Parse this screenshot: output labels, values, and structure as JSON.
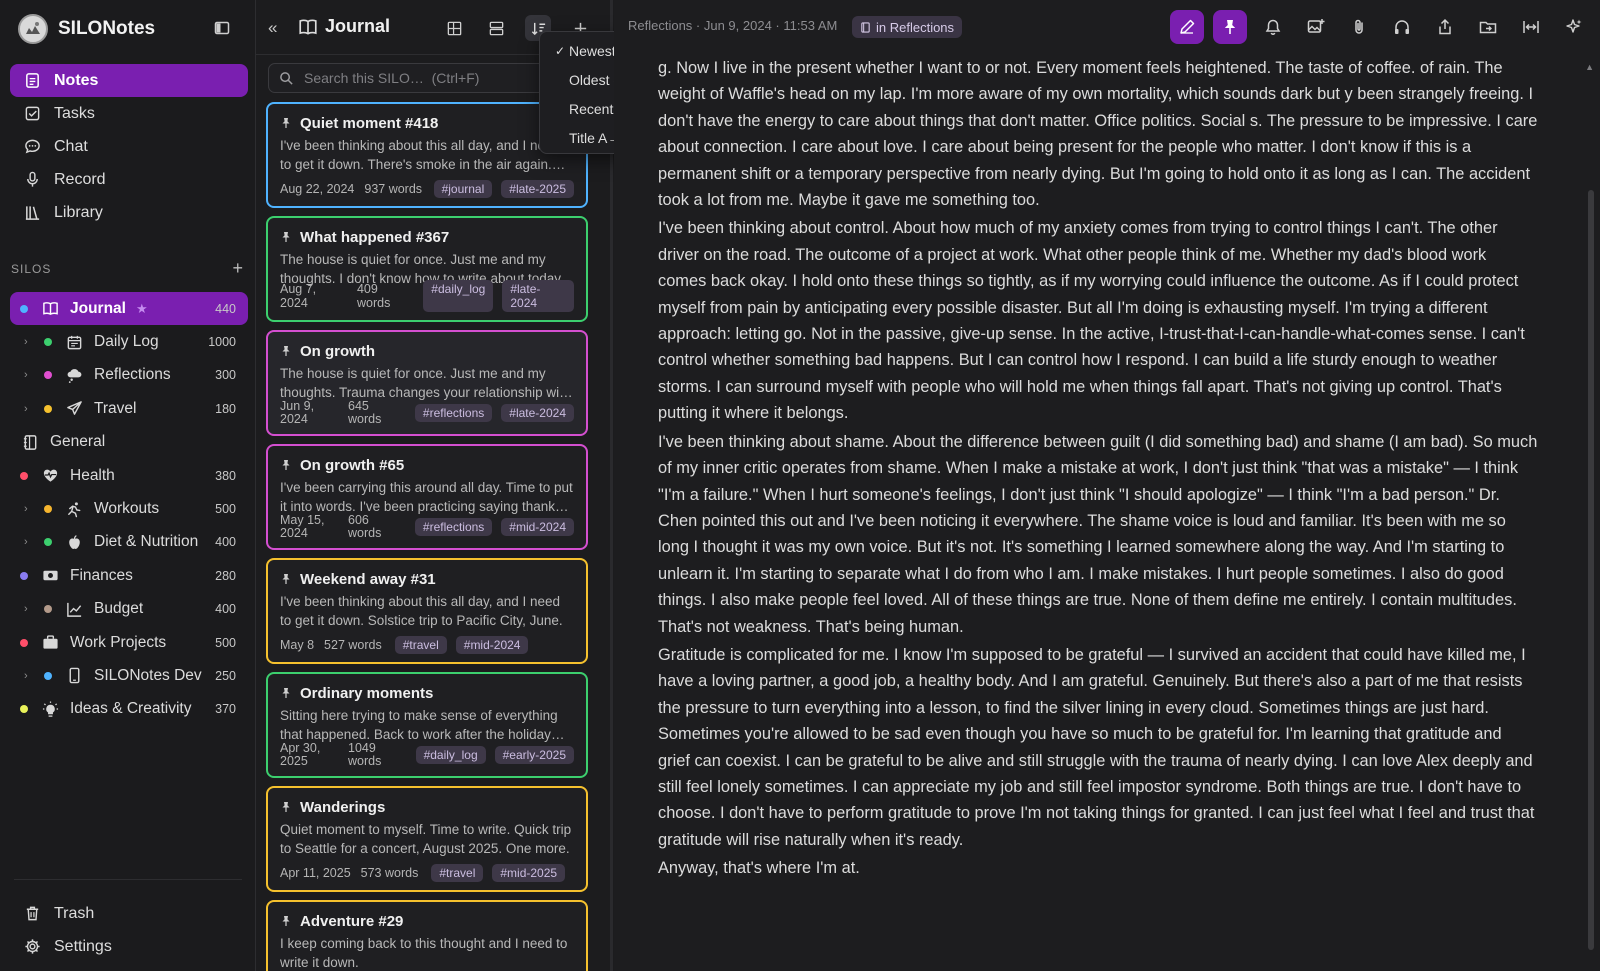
{
  "app": {
    "name": "SILONotes"
  },
  "nav": [
    {
      "label": "Notes",
      "icon": "notes-icon",
      "active": true
    },
    {
      "label": "Tasks",
      "icon": "tasks-icon"
    },
    {
      "label": "Chat",
      "icon": "chat-icon"
    },
    {
      "label": "Record",
      "icon": "microphone-icon"
    },
    {
      "label": "Library",
      "icon": "library-icon"
    }
  ],
  "silos_header": {
    "label": "SILOS",
    "add": "+"
  },
  "silos": [
    {
      "label": "Journal",
      "count": "440",
      "dot": "#4fb3ff",
      "icon": "book-icon",
      "active": true,
      "star": "★"
    },
    {
      "label": "Daily Log",
      "count": "1000",
      "dot": "#3ccf6e",
      "icon": "calendar-icon",
      "chevron": "›"
    },
    {
      "label": "Reflections",
      "count": "300",
      "dot": "#e04fd0",
      "icon": "thought-icon",
      "chevron": "›"
    },
    {
      "label": "Travel",
      "count": "180",
      "dot": "#f5c12e",
      "icon": "plane-icon",
      "chevron": "›"
    },
    {
      "label": "General",
      "count": "",
      "dot": "",
      "icon": "notebook-icon"
    },
    {
      "label": "Health",
      "count": "380",
      "dot": "#ff4f6a",
      "icon": "heartbeat-icon"
    },
    {
      "label": "Workouts",
      "count": "500",
      "dot": "#f5b52e",
      "icon": "run-icon",
      "chevron": "›"
    },
    {
      "label": "Diet & Nutrition",
      "count": "400",
      "dot": "#3ccf6e",
      "icon": "apple-icon",
      "chevron": "›"
    },
    {
      "label": "Finances",
      "count": "280",
      "dot": "#8a7cf0",
      "icon": "money-icon"
    },
    {
      "label": "Budget",
      "count": "400",
      "dot": "#b39a8a",
      "icon": "chart-line-icon",
      "chevron": "›"
    },
    {
      "label": "Work Projects",
      "count": "500",
      "dot": "#ff4f6a",
      "icon": "briefcase-icon"
    },
    {
      "label": "SILONotes Dev",
      "count": "250",
      "dot": "#4fb3ff",
      "icon": "phone-icon",
      "chevron": "›"
    },
    {
      "label": "Ideas & Creativity",
      "count": "370",
      "dot": "#e9f25a",
      "icon": "lightbulb-icon"
    }
  ],
  "bottom_nav": [
    {
      "label": "Trash",
      "icon": "trash-icon"
    },
    {
      "label": "Settings",
      "icon": "gear-icon"
    }
  ],
  "list": {
    "back": "«",
    "title": "Journal",
    "search_placeholder": "Search this SILO…  (Ctrl+F)"
  },
  "sort_menu": {
    "items": [
      {
        "label": "Newest created",
        "checked": "✓"
      },
      {
        "label": "Oldest created",
        "checked": ""
      },
      {
        "label": "Recently updated",
        "checked": ""
      },
      {
        "label": "Title A→Z",
        "checked": ""
      }
    ]
  },
  "notes": [
    {
      "title": "Quiet moment #418",
      "excerpt": "I've been thinking about this all day, and I need to get it down. There's smoke in the air again. Fire season is here.",
      "date": "Aug 22, 2024",
      "words": "937 words",
      "tags": [
        "#journal",
        "#late-2025"
      ],
      "color": "#4fb3ff"
    },
    {
      "title": "What happened #367",
      "excerpt": "The house is quiet for once. Just me and my thoughts. I don't know how to write about today.",
      "date": "Aug 7, 2024",
      "words": "409 words",
      "tags": [
        "#daily_log",
        "#late-2024"
      ],
      "color": "#3ccf6e"
    },
    {
      "title": "On growth",
      "excerpt": "The house is quiet for once. Just me and my thoughts. Trauma changes your relationship with time.",
      "date": "Jun 9, 2024",
      "words": "645 words",
      "tags": [
        "#reflections",
        "#late-2024"
      ],
      "color": "#d44fd0",
      "selected": true,
      "stack": true
    },
    {
      "title": "On growth #65",
      "excerpt": "I've been carrying this around all day. Time to put it into words. I've been practicing saying thank you.",
      "date": "May 15, 2024",
      "words": "606 words",
      "tags": [
        "#reflections",
        "#mid-2024"
      ],
      "color": "#d44fd0",
      "stack": true
    },
    {
      "title": "Weekend away #31",
      "excerpt": "I've been thinking about this all day, and I need to get it down. Solstice trip to Pacific City, June.",
      "date": "May 8",
      "words": "527 words",
      "tags": [
        "#travel",
        "#mid-2024"
      ],
      "color": "#f5c12e"
    },
    {
      "title": "Ordinary moments",
      "excerpt": "Sitting here trying to make sense of everything that happened. Back to work after the holiday break.",
      "date": "Apr 30, 2025",
      "words": "1049 words",
      "tags": [
        "#daily_log",
        "#early-2025"
      ],
      "color": "#3ccf6e",
      "stack": true
    },
    {
      "title": "Wanderings",
      "excerpt": "Quiet moment to myself. Time to write. Quick trip to Seattle for a concert, August 2025. One more.",
      "date": "Apr 11, 2025",
      "words": "573 words",
      "tags": [
        "#travel",
        "#mid-2025"
      ],
      "color": "#f5c12e"
    },
    {
      "title": "Adventure #29",
      "excerpt": "I keep coming back to this thought and I need to write it down.",
      "date": "",
      "words": "",
      "tags": [],
      "color": "#f5c12e"
    }
  ],
  "editor": {
    "breadcrumb": "Reflections · Jun 9, 2024 · 11:53 AM",
    "silo_chip": "in Reflections",
    "tools": [
      "pencil-icon",
      "pin-icon",
      "bell-icon",
      "image-add-icon",
      "paperclip-icon",
      "headphones-icon",
      "share-icon",
      "folder-move-icon",
      "expand-width-icon",
      "sparkle-icon"
    ],
    "paragraphs": [
      "g. Now I live in the present whether I want to or not. Every moment feels heightened. The taste of coffee. of rain. The weight of Waffle's head on my lap. I'm more aware of my own mortality, which sounds dark but y been strangely freeing. I don't have the energy to care about things that don't matter. Office politics. Social s. The pressure to be impressive. I care about connection. I care about love. I care about being present for the people who matter. I don't know if this is a permanent shift or a temporary perspective from nearly dying. But I'm going to hold onto it as long as I can. The accident took a lot from me. Maybe it gave me something too.",
      "I've been thinking about control. About how much of my anxiety comes from trying to control things I can't. The other driver on the road. The outcome of a project at work. What other people think of me. Whether my dad's blood work comes back okay. I hold onto these things so tightly, as if my worrying could influence the outcome. As if I could protect myself from pain by anticipating every possible disaster. But all I'm doing is exhausting myself. I'm trying a different approach: letting go. Not in the passive, give-up sense. In the active, I-trust-that-I-can-handle-what-comes sense. I can't control whether something bad happens. But I can control how I respond. I can build a life sturdy enough to weather storms. I can surround myself with people who will hold me when things fall apart. That's not giving up control. That's putting it where it belongs.",
      "I've been thinking about shame. About the difference between guilt (I did something bad) and shame (I am bad). So much of my inner critic operates from shame. When I make a mistake at work, I don't just think \"that was a mistake\" — I think \"I'm a failure.\" When I hurt someone's feelings, I don't just think \"I should apologize\" — I think \"I'm a bad person.\" Dr. Chen pointed this out and I've been noticing it everywhere. The shame voice is loud and familiar. It's been with me so long I thought it was my own voice. But it's not. It's something I learned somewhere along the way. And I'm starting to unlearn it. I'm starting to separate what I do from who I am. I make mistakes. I hurt people sometimes. I also do good things. I also make people feel loved. All of these things are true. None of them define me entirely. I contain multitudes. That's not weakness. That's being human.",
      "Gratitude is complicated for me. I know I'm supposed to be grateful — I survived an accident that could have killed me, I have a loving partner, a good job, a healthy body. And I am grateful. Genuinely. But there's also a part of me that resists the pressure to turn everything into a lesson, to find the silver lining in every cloud. Sometimes things are just hard. Sometimes you're allowed to be sad even though you have so much to be grateful for. I'm learning that gratitude and grief can coexist. I can be grateful to be alive and still struggle with the trauma of nearly dying. I can love Alex deeply and still feel lonely sometimes. I can appreciate my job and still feel impostor syndrome. Both things are true. I don't have to choose. I don't have to perform gratitude to prove I'm not taking things for granted. I can just feel what I feel and trust that gratitude will rise naturally when it's ready.",
      "Anyway, that's where I'm at."
    ]
  }
}
